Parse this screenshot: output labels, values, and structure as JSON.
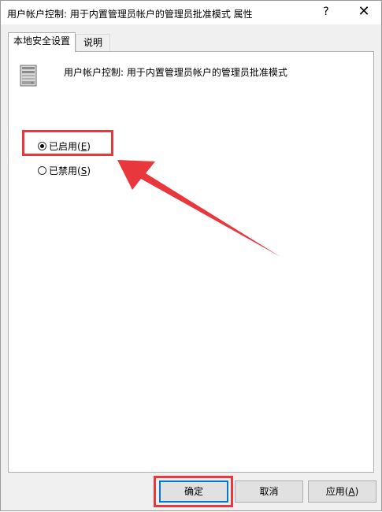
{
  "window": {
    "title": "用户帐户控制: 用于内置管理员帐户的管理员批准模式 属性",
    "help_glyph": "?",
    "close_glyph": "✕"
  },
  "tabs": [
    {
      "label": "本地安全设置",
      "active": true
    },
    {
      "label": "说明",
      "active": false
    }
  ],
  "policy": {
    "title": "用户帐户控制: 用于内置管理员帐户的管理员批准模式",
    "icon": "server-computer-icon"
  },
  "options": {
    "enabled": {
      "label": "已启用(",
      "key": "E",
      "suffix": ")",
      "checked": true
    },
    "disabled": {
      "label": "已禁用(",
      "key": "S",
      "suffix": ")",
      "checked": false
    }
  },
  "buttons": {
    "ok": "确定",
    "cancel": "取消",
    "apply_label": "应用(",
    "apply_key": "A",
    "apply_suffix": ")"
  },
  "annotation_color": "#e8383d"
}
